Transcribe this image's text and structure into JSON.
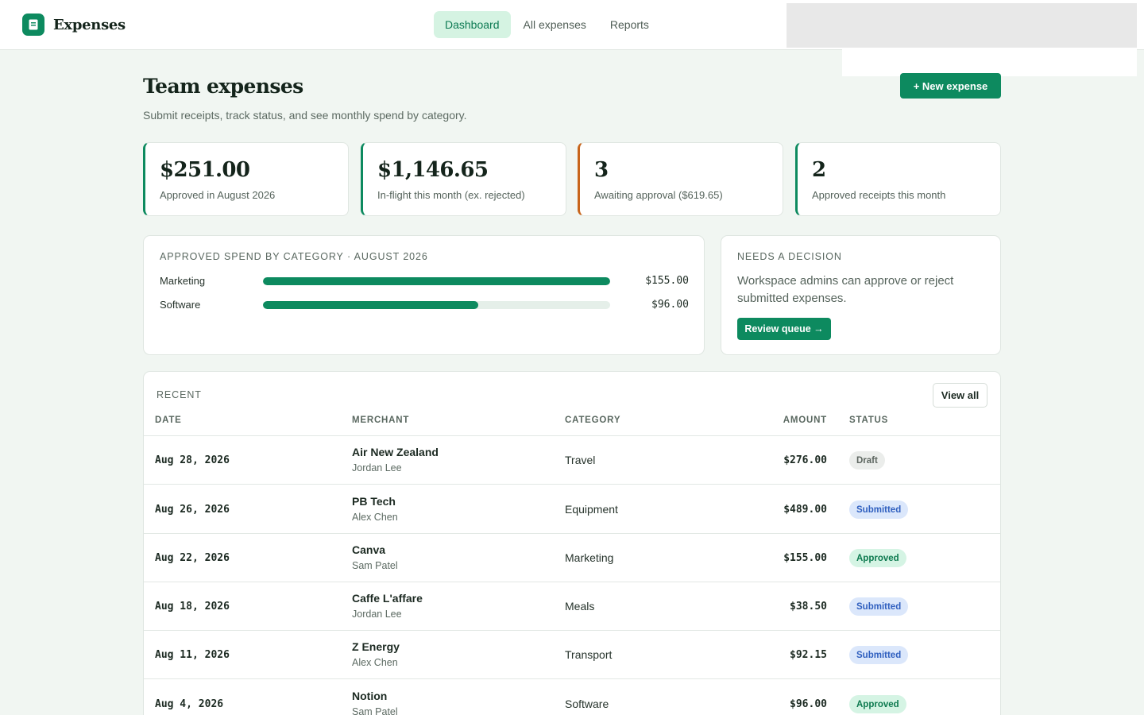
{
  "app": {
    "name": "Expenses",
    "logo_icon": "receipt-icon",
    "accent": "#0d8a5f"
  },
  "nav": {
    "items": [
      {
        "label": "Dashboard",
        "active": true
      },
      {
        "label": "All expenses",
        "active": false
      },
      {
        "label": "Reports",
        "active": false
      }
    ]
  },
  "header": {
    "title": "Team expenses",
    "subtitle": "Submit receipts, track status, and see monthly spend by category.",
    "new_button": "+ New expense"
  },
  "stats": [
    {
      "value": "$251.00",
      "label": "Approved in August 2026",
      "accent": "#0d8a5f"
    },
    {
      "value": "$1,146.65",
      "label": "In-flight this month (ex. rejected)",
      "accent": "#0d8a5f"
    },
    {
      "value": "3",
      "label": "Awaiting approval ($619.65)",
      "accent": "#c8641b"
    },
    {
      "value": "2",
      "label": "Approved receipts this month",
      "accent": "#0d8a5f"
    }
  ],
  "category_panel": {
    "heading": "Approved spend by category · August 2026",
    "rows": [
      {
        "name": "Marketing",
        "amount": "$155.00",
        "fraction": 1.0
      },
      {
        "name": "Software",
        "amount": "$96.00",
        "fraction": 0.619
      }
    ]
  },
  "decision_panel": {
    "heading": "Needs a decision",
    "text": "Workspace admins can approve or reject submitted expenses.",
    "button": "Review queue →"
  },
  "recent": {
    "heading": "Recent",
    "view_all": "View all",
    "columns": [
      "Date",
      "Merchant",
      "Category",
      "Amount",
      "Status"
    ],
    "rows": [
      {
        "date": "Aug 28, 2026",
        "merchant": "Air New Zealand",
        "person": "Jordan Lee",
        "category": "Travel",
        "amount": "$276.00",
        "status": "Draft",
        "status_kind": "draft"
      },
      {
        "date": "Aug 26, 2026",
        "merchant": "PB Tech",
        "person": "Alex Chen",
        "category": "Equipment",
        "amount": "$489.00",
        "status": "Submitted",
        "status_kind": "submitted"
      },
      {
        "date": "Aug 22, 2026",
        "merchant": "Canva",
        "person": "Sam Patel",
        "category": "Marketing",
        "amount": "$155.00",
        "status": "Approved",
        "status_kind": "approved"
      },
      {
        "date": "Aug 18, 2026",
        "merchant": "Caffe L'affare",
        "person": "Jordan Lee",
        "category": "Meals",
        "amount": "$38.50",
        "status": "Submitted",
        "status_kind": "submitted"
      },
      {
        "date": "Aug 11, 2026",
        "merchant": "Z Energy",
        "person": "Alex Chen",
        "category": "Transport",
        "amount": "$92.15",
        "status": "Submitted",
        "status_kind": "submitted"
      },
      {
        "date": "Aug 4, 2026",
        "merchant": "Notion",
        "person": "Sam Patel",
        "category": "Software",
        "amount": "$96.00",
        "status": "Approved",
        "status_kind": "approved"
      }
    ]
  }
}
